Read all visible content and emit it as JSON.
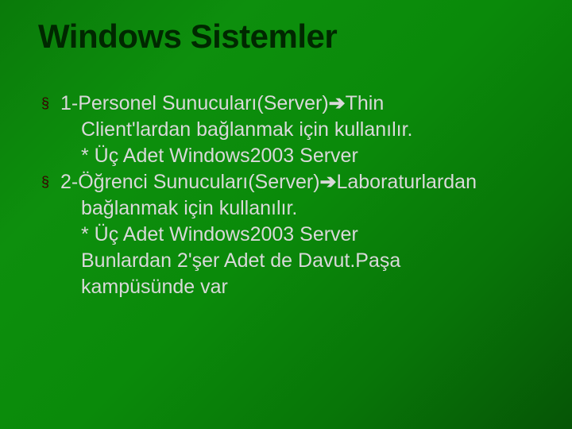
{
  "slide": {
    "title": "Windows Sistemler",
    "lines": {
      "l1a": "1-Personel Sunucuları(Server)",
      "arrow1": "➔",
      "l1b": "Thin",
      "l2": "Client'lardan bağlanmak için kullanılır.",
      "l3": "* Üç Adet Windows2003 Server",
      "l4a": "2-Öğrenci Sunucuları(Server)",
      "arrow2": "➔",
      "l4b": "Laboraturlardan",
      "l5": "bağlanmak için kullanılır.",
      "l6": "* Üç Adet Windows2003 Server",
      "l7": "Bunlardan 2'şer Adet de Davut.Paşa",
      "l8": "kampüsünde var"
    }
  }
}
